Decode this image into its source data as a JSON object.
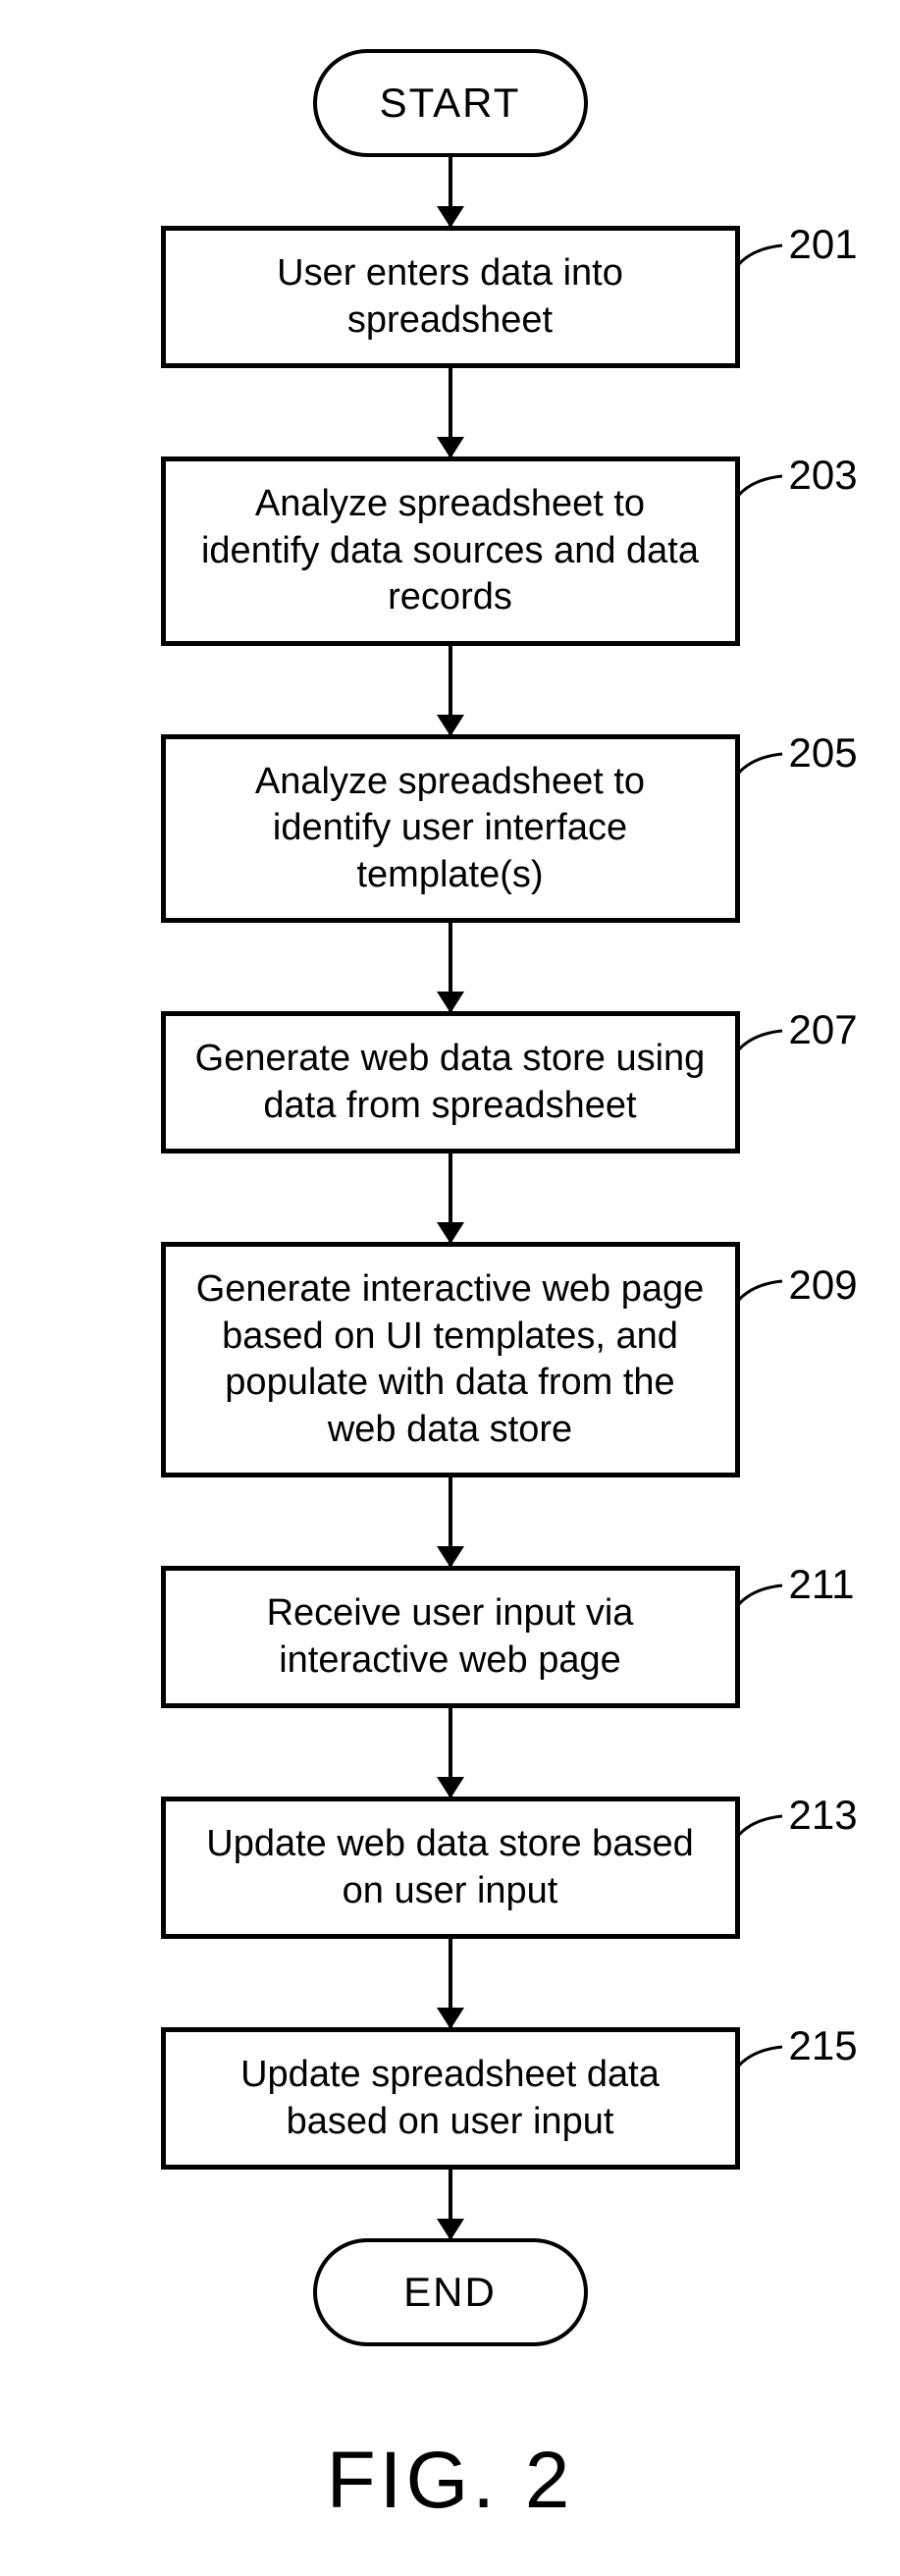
{
  "flowchart": {
    "start": "START",
    "end": "END",
    "figure_label": "FIG. 2",
    "steps": [
      {
        "text": "User enters data into spreadsheet",
        "ref": "201"
      },
      {
        "text": "Analyze spreadsheet to identify data sources and data records",
        "ref": "203"
      },
      {
        "text": "Analyze spreadsheet to identify user interface template(s)",
        "ref": "205"
      },
      {
        "text": "Generate web data store using data from spreadsheet",
        "ref": "207"
      },
      {
        "text": "Generate interactive web page based on UI templates, and populate with data from the web data store",
        "ref": "209"
      },
      {
        "text": "Receive user input via interactive web page",
        "ref": "211"
      },
      {
        "text": "Update web data store based on user input",
        "ref": "213"
      },
      {
        "text": "Update spreadsheet data based on user input",
        "ref": "215"
      }
    ]
  }
}
